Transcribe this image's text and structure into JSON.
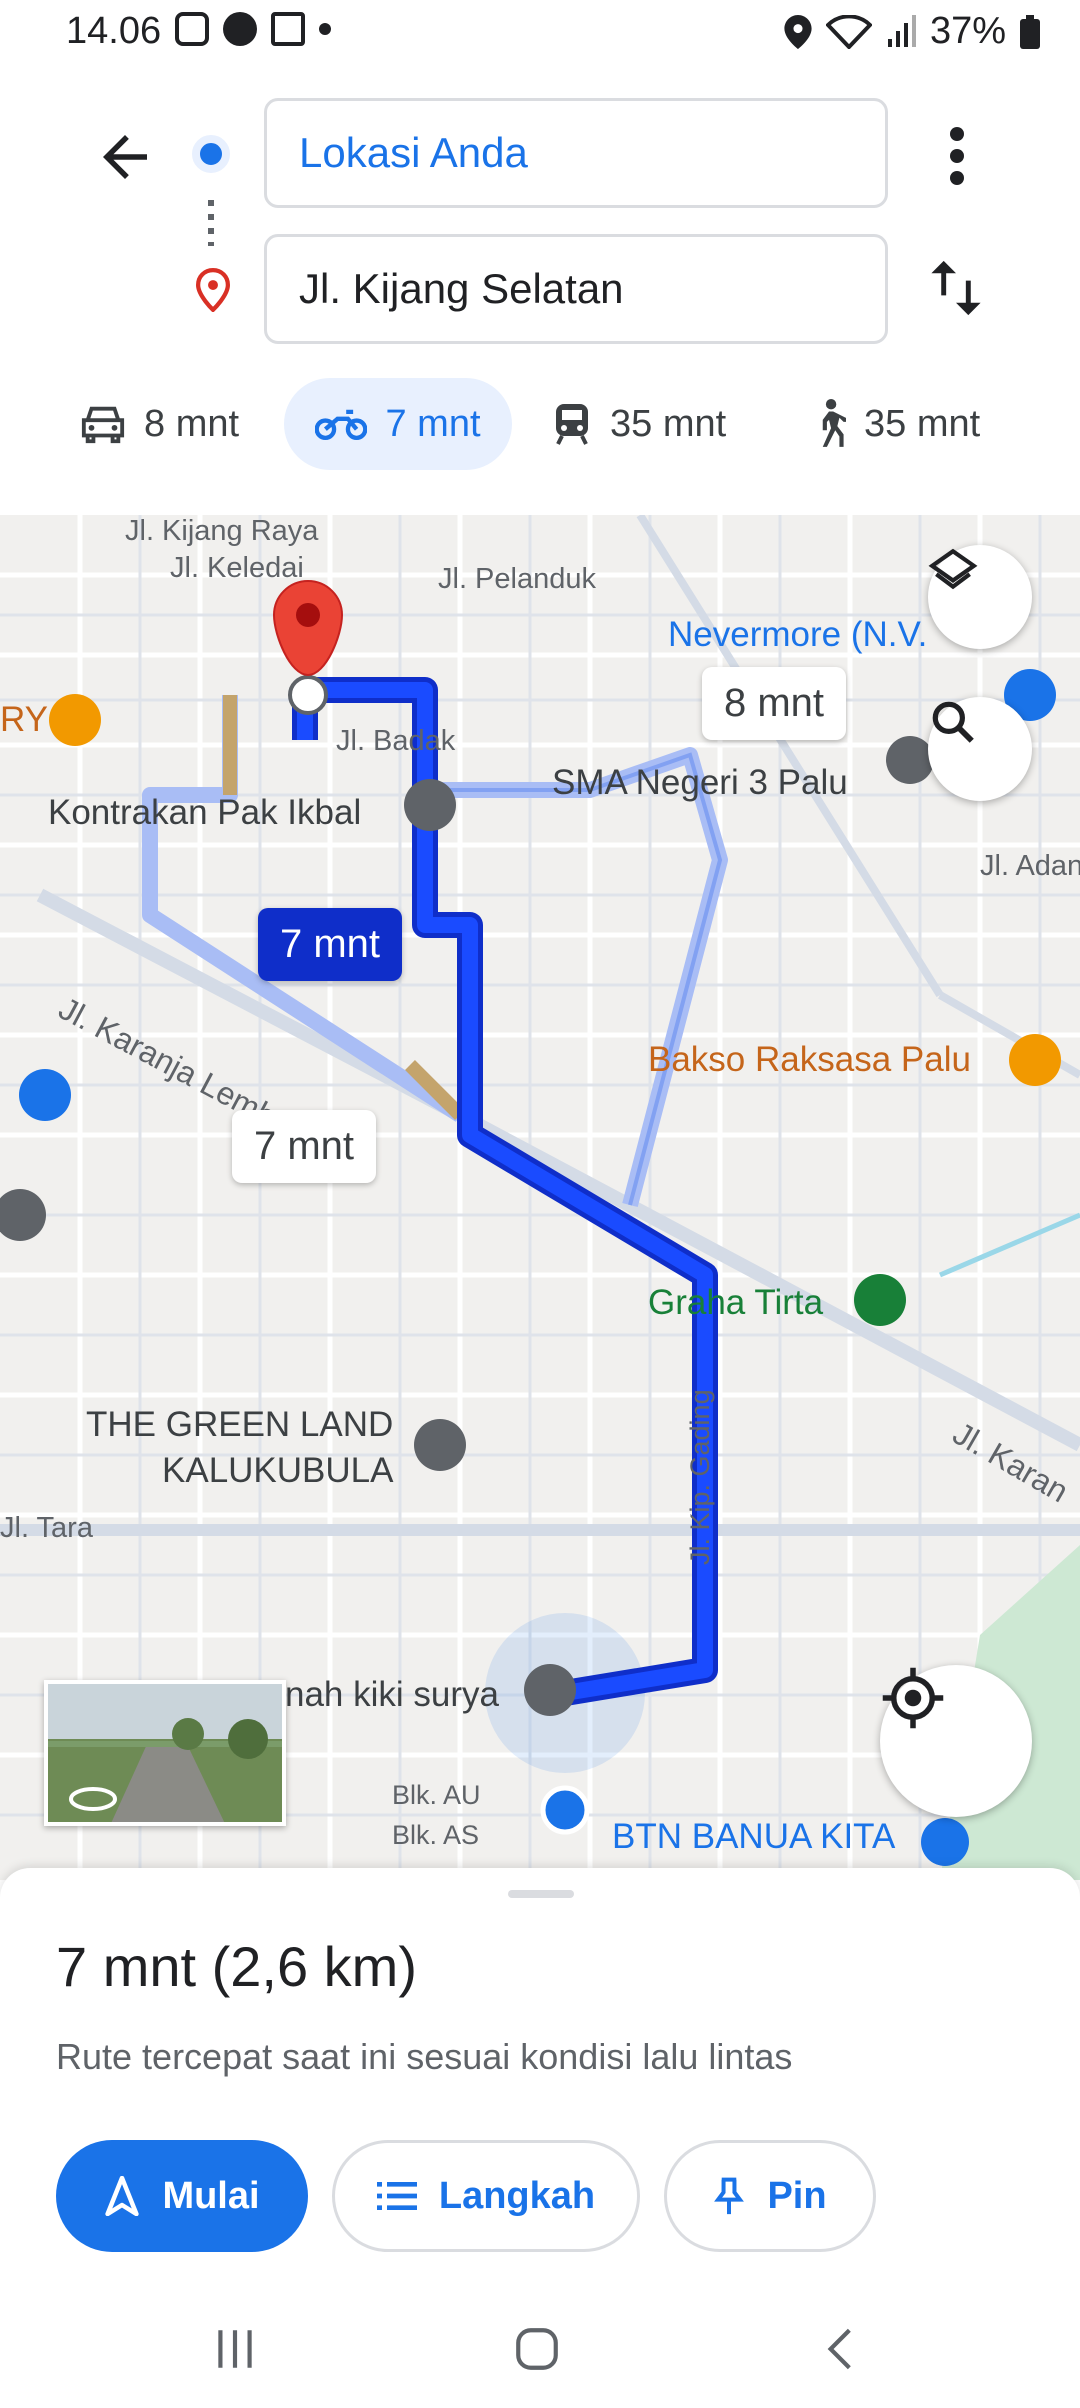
{
  "status_bar": {
    "time": "14.06",
    "battery": "37%"
  },
  "search": {
    "origin": "Lokasi Anda",
    "destination": "Jl. Kijang Selatan"
  },
  "modes": [
    {
      "label": "8 mnt",
      "icon": "car-icon"
    },
    {
      "label": "7 mnt",
      "icon": "motorcycle-icon",
      "selected": true
    },
    {
      "label": "35 mnt",
      "icon": "transit-icon"
    },
    {
      "label": "35 mnt",
      "icon": "walk-icon"
    }
  ],
  "map": {
    "streets": [
      "Jl. Kijang Raya",
      "Jl. Keledai",
      "Jl. Pelanduk",
      "Jl. Badak",
      "Jl. Karanja Lembah",
      "Jl. Adan",
      "Jl. Karan",
      "Jl. Tara",
      "Jl. Kip. Gading",
      "Blk. AU",
      "Blk. AS"
    ],
    "places": [
      "Nevermore (N.V.",
      "SMA Negeri 3 Palu",
      "Kontrakan Pak Ikbal",
      "Bakso Raksasa Palu",
      "Graha Tirta",
      "THE GREEN LAND",
      "KALUKUBULA",
      "nah kiki surya",
      "BTN BANUA KITA",
      "RY"
    ],
    "route_labels": {
      "primary": "7 mnt",
      "alt1": "8 mnt",
      "alt2": "7 mnt"
    }
  },
  "summary": {
    "eta": "7 mnt (2,6 km)",
    "description": "Rute tercepat saat ini sesuai kondisi lalu lintas"
  },
  "actions": {
    "start": "Mulai",
    "steps": "Langkah",
    "pin": "Pin"
  },
  "colors": {
    "accent": "#1a73e8",
    "route": "#0f2ec9",
    "alt_route": "#a9bdf5"
  }
}
